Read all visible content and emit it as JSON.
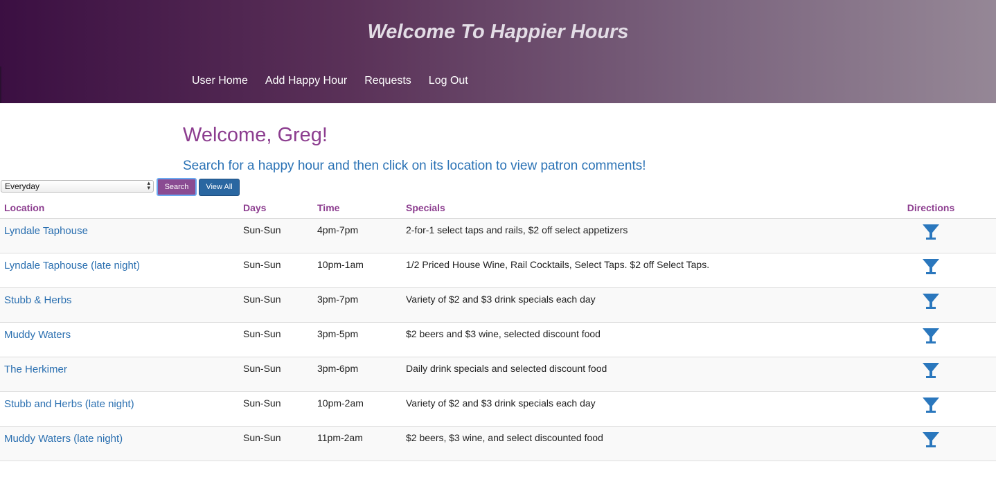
{
  "header": {
    "title": "Welcome To Happier Hours",
    "nav": [
      "User Home",
      "Add Happy Hour",
      "Requests",
      "Log Out"
    ]
  },
  "main": {
    "welcome": "Welcome, Greg!",
    "subtitle": "Search for a happy hour and then click on its location to view patron comments!"
  },
  "filter": {
    "day_select_value": "Everyday",
    "search_label": "Search",
    "view_all_label": "View All"
  },
  "table": {
    "headers": {
      "location": "Location",
      "days": "Days",
      "time": "Time",
      "specials": "Specials",
      "directions": "Directions"
    },
    "rows": [
      {
        "location": "Lyndale Taphouse",
        "days": "Sun-Sun",
        "time": "4pm-7pm",
        "specials": "2-for-1 select taps and rails, $2 off select appetizers"
      },
      {
        "location": "Lyndale Taphouse (late night)",
        "days": "Sun-Sun",
        "time": "10pm-1am",
        "specials": "1/2 Priced House Wine, Rail Cocktails, Select Taps. $2 off Select Taps."
      },
      {
        "location": "Stubb & Herbs",
        "days": "Sun-Sun",
        "time": "3pm-7pm",
        "specials": "Variety of $2 and $3 drink specials each day"
      },
      {
        "location": "Muddy Waters",
        "days": "Sun-Sun",
        "time": "3pm-5pm",
        "specials": "$2 beers and $3 wine, selected discount food"
      },
      {
        "location": "The Herkimer",
        "days": "Sun-Sun",
        "time": "3pm-6pm",
        "specials": "Daily drink specials and selected discount food"
      },
      {
        "location": "Stubb and Herbs (late night)",
        "days": "Sun-Sun",
        "time": "10pm-2am",
        "specials": "Variety of $2 and $3 drink specials each day"
      },
      {
        "location": "Muddy Waters (late night)",
        "days": "Sun-Sun",
        "time": "11pm-2am",
        "specials": "$2 beers, $3 wine, and select discounted food"
      }
    ],
    "directions_icon": "cocktail-glass-icon"
  },
  "colors": {
    "header_gradient_start": "#3b0f42",
    "header_gradient_end": "#958796",
    "accent_purple": "#8c3d8f",
    "link_blue": "#2a6fb0",
    "search_button": "#8a4b92",
    "view_all_button": "#2a67a1"
  }
}
